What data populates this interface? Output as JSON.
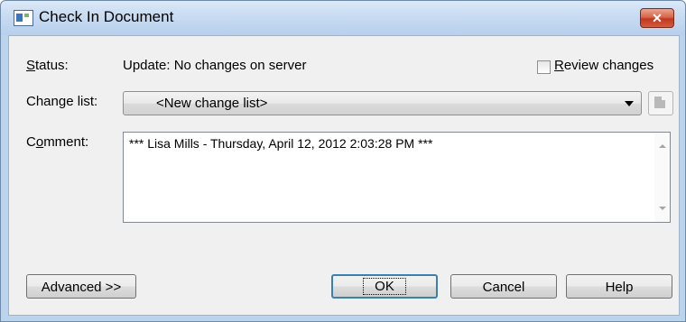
{
  "window": {
    "title": "Check In Document",
    "close_glyph": "✕"
  },
  "status": {
    "label": "Status:",
    "label_access": "S",
    "label_rest": "tatus:",
    "value": "Update: No changes on server"
  },
  "review": {
    "label_access": "R",
    "label_rest": "eview changes",
    "checked": false
  },
  "change_list": {
    "label": "Change list:",
    "label_access": "g",
    "value": "<New change list>"
  },
  "comment": {
    "label_access": "o",
    "label_pre": "C",
    "label_rest": "mment:",
    "text": "*** Lisa Mills - Thursday, April 12, 2012 2:03:28 PM ***"
  },
  "buttons": {
    "advanced": "Advanced >>",
    "ok": "OK",
    "cancel": "Cancel",
    "help": "Help"
  },
  "colors": {
    "title_bg": "#c6daf1",
    "client_bg": "#f0f0f0",
    "close_red": "#c0391f",
    "default_button_border": "#3c7fb1"
  },
  "icons": {
    "app": "document-window-icon",
    "side_button": "properties-icon"
  }
}
